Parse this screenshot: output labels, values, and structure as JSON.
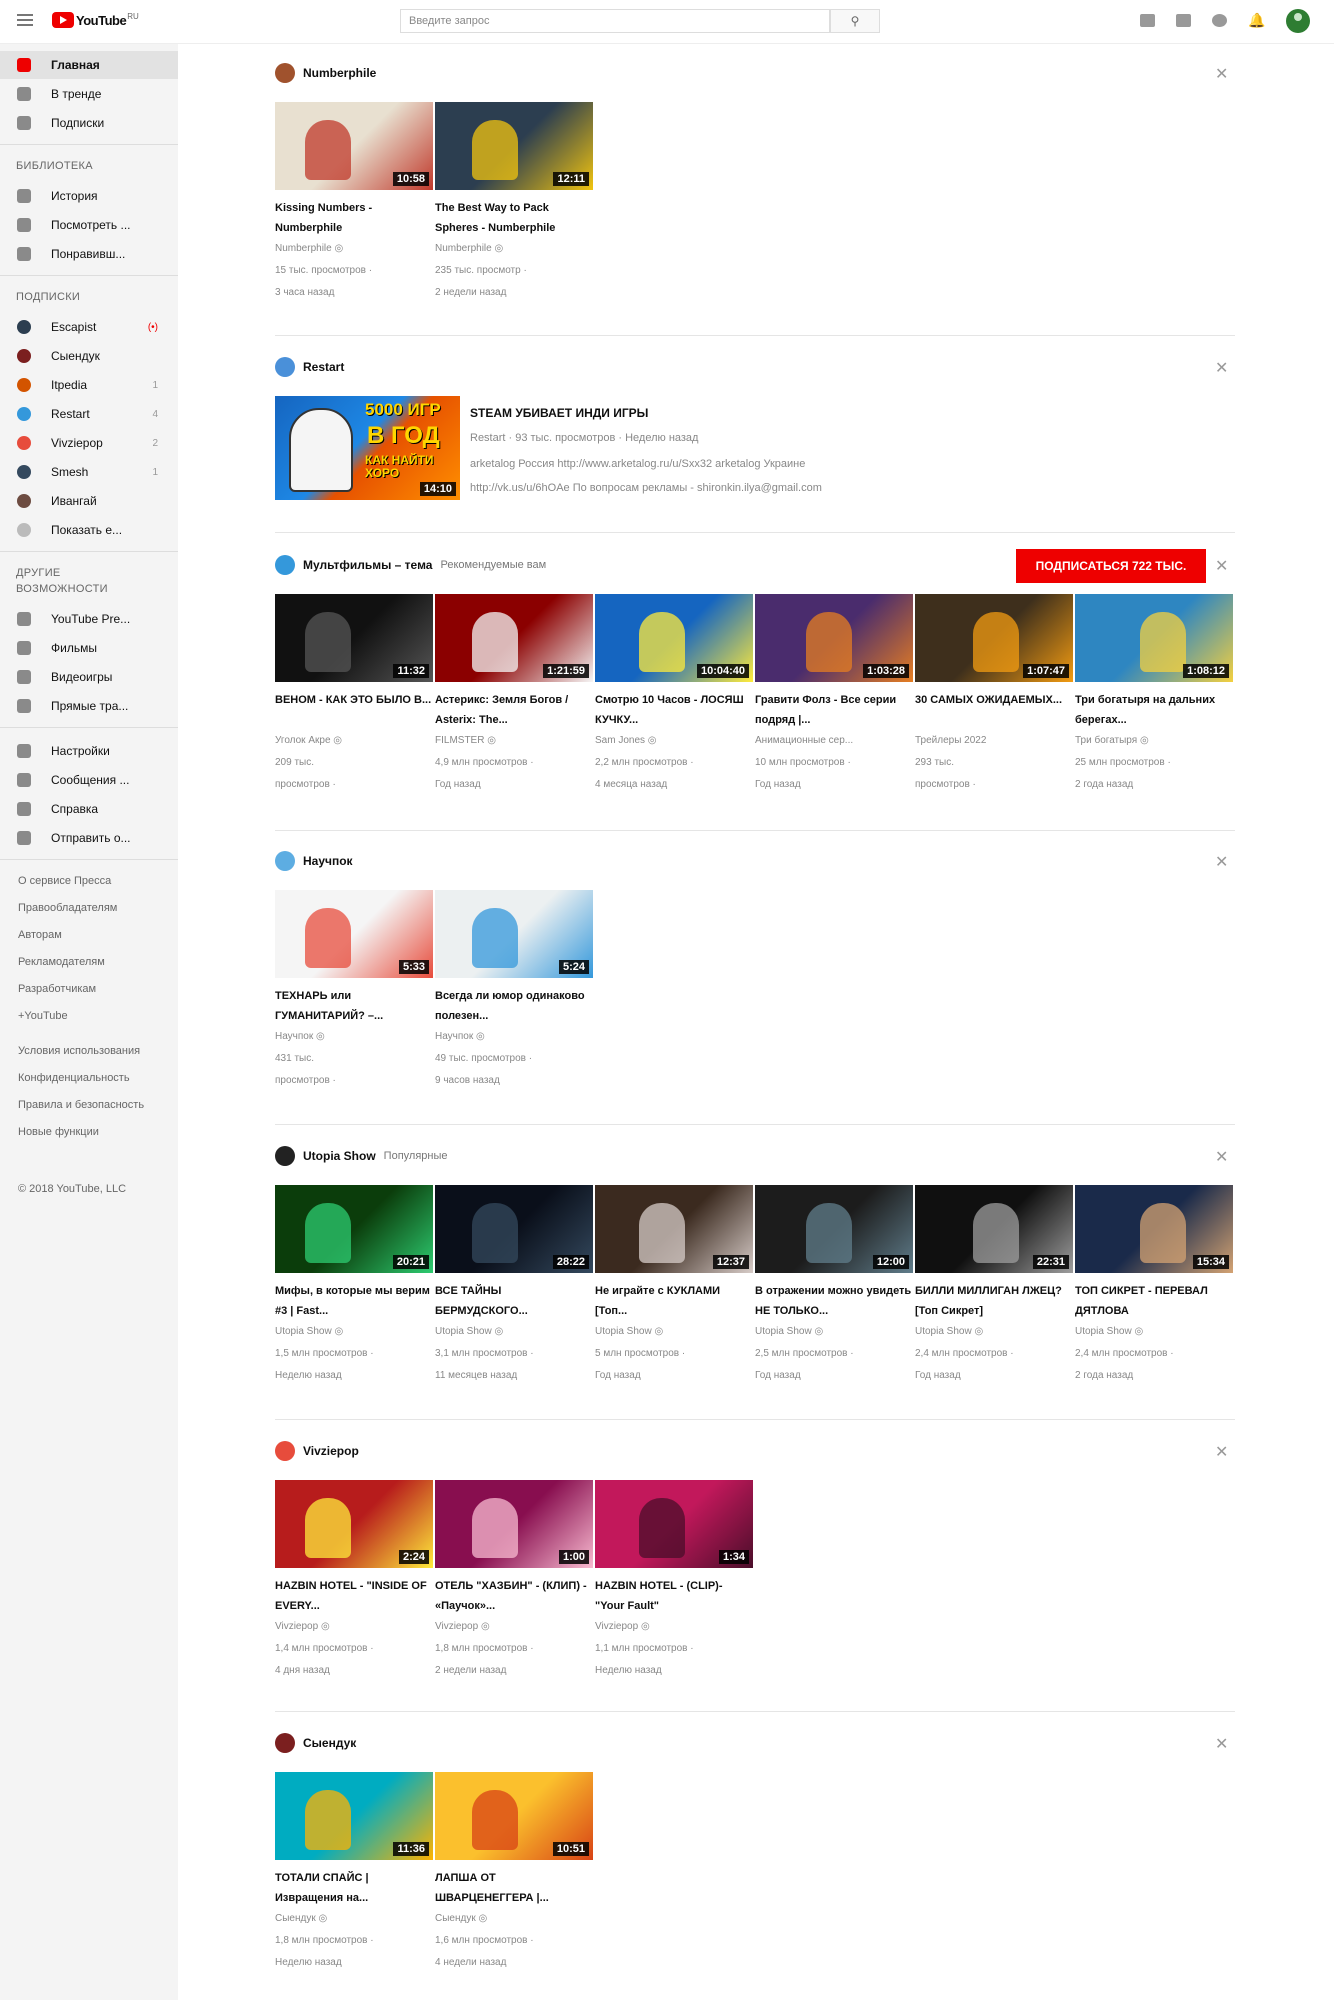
{
  "header": {
    "logo_text": "YouTube",
    "logo_region": "RU",
    "search_placeholder": "Введите запрос"
  },
  "sidebar": {
    "main": [
      {
        "label": "Главная",
        "icon": "home-icon",
        "active": true
      },
      {
        "label": "В тренде",
        "icon": "flame-icon"
      },
      {
        "label": "Подписки",
        "icon": "subscriptions-icon"
      }
    ],
    "library_header": "БИБЛИОТЕКА",
    "library": [
      {
        "label": "История",
        "icon": "history-icon"
      },
      {
        "label": "Посмотреть ...",
        "icon": "watch-later-icon"
      },
      {
        "label": "Понравивш...",
        "icon": "thumbs-up-icon"
      }
    ],
    "subscriptions_header": "ПОДПИСКИ",
    "subscriptions": [
      {
        "label": "Escapist",
        "count": "(•)"
      },
      {
        "label": "Сыендук",
        "count": ""
      },
      {
        "label": "Itpedia",
        "count": "1"
      },
      {
        "label": "Restart",
        "count": "4"
      },
      {
        "label": "Vivziepop",
        "count": "2"
      },
      {
        "label": "Smesh",
        "count": "1"
      },
      {
        "label": "Ивангай",
        "count": ""
      },
      {
        "label": "Показать е...",
        "count": ""
      }
    ],
    "other_header_1": "ДРУГИЕ",
    "other_header_2": "ВОЗМОЖНОСТИ",
    "other": [
      {
        "label": "YouTube Pre...",
        "icon": "youtube-premium-icon"
      },
      {
        "label": "Фильмы",
        "icon": "film-icon"
      },
      {
        "label": "Видеоигры",
        "icon": "gamepad-icon"
      },
      {
        "label": "Прямые тра...",
        "icon": "live-icon"
      }
    ],
    "settings": [
      {
        "label": "Настройки",
        "icon": "gear-icon"
      },
      {
        "label": "Сообщения ...",
        "icon": "flag-icon"
      },
      {
        "label": "Справка",
        "icon": "help-icon"
      },
      {
        "label": "Отправить о...",
        "icon": "feedback-icon"
      }
    ],
    "footer_links_1": [
      "О сервисе Пресса",
      "Правообладателям",
      "Авторам",
      "Рекламодателям",
      "Разработчикам",
      "+YouTube"
    ],
    "footer_links_2": [
      "Условия использования",
      "Конфиденциальность",
      "Правила и безопасность",
      "Новые функции"
    ],
    "copyright": "© 2018 YouTube, LLC"
  },
  "sections": [
    {
      "channel": "Numberphile",
      "subtitle": "",
      "icon_color": "#a0522d",
      "videos": [
        {
          "title": "Kissing Numbers - Numberphile",
          "channel": "Numberphile ◎",
          "views": "15 тыс. просмотров ·",
          "age": "3 часа назад",
          "duration": "10:58",
          "colors": [
            "#e8e0d0",
            "#c0392b"
          ]
        },
        {
          "title": "The Best Way to Pack Spheres - Numberphile",
          "channel": "Numberphile ◎",
          "views": "235 тыс. просмотр ·",
          "age": "2 недели назад",
          "duration": "12:11",
          "colors": [
            "#2c3e50",
            "#f1c40f"
          ]
        }
      ]
    },
    {
      "channel": "Restart",
      "subtitle": "",
      "icon_color": "#4a90d9",
      "wide": {
        "title": "STEAM УБИВАЕТ ИНДИ ИГРЫ",
        "meta": "Restart · 93 тыс. просмотров · Неделю назад",
        "line2": "arketalog Россия http://www.arketalog.ru/u/Sxx32 arketalog Украине",
        "line3": "http://vk.us/u/6hOAe По вопросам рекламы - shironkin.ilya@gmail.com",
        "duration": "14:10",
        "thumb_text_1": "5000 ИГР",
        "thumb_text_2": "В ГОД",
        "thumb_text_3": "КАК НАЙТИ ХОРО"
      }
    },
    {
      "channel": "Мультфильмы – тема",
      "subtitle": "Рекомендуемые вам",
      "icon_color": "#3498db",
      "subscribe": "ПОДПИСАТЬСЯ 722 ТЫС.",
      "videos": [
        {
          "title": "ВЕНОМ - КАК ЭТО БЫЛО В...",
          "channel": "Уголок Акре ◎",
          "views": "209 тыс.",
          "age": "просмотров ·",
          "duration": "11:32",
          "colors": [
            "#111111",
            "#555555"
          ]
        },
        {
          "title": "Астерикс: Земля Богов / Asterix: The...",
          "channel": "FILMSTER ◎",
          "views": "4,9 млн просмотров ·",
          "age": "Год назад",
          "duration": "1:21:59",
          "colors": [
            "#8b0000",
            "#f5f5f5"
          ]
        },
        {
          "title": "Смотрю 10 Часов - ЛОСЯШ КУЧКУ...",
          "channel": "Sam Jones ◎",
          "views": "2,2 млн просмотров ·",
          "age": "4 месяца назад",
          "duration": "10:04:40",
          "colors": [
            "#1565c0",
            "#ffeb3b"
          ]
        },
        {
          "title": "Гравити Фолз - Все серии подряд |...",
          "channel": "Анимационные сер...",
          "views": "10 млн просмотров ·",
          "age": "Год назад",
          "duration": "1:03:28",
          "colors": [
            "#4a2c6d",
            "#e67e22"
          ]
        },
        {
          "title": "30 САМЫХ ОЖИДАЕМЫХ...",
          "channel": "Трейлеры 2022",
          "views": "293 тыс.",
          "age": "просмотров ·",
          "duration": "1:07:47",
          "colors": [
            "#3e2f1c",
            "#f39c12"
          ]
        },
        {
          "title": "Три богатыря на дальних берегах...",
          "channel": "Три богатыря ◎",
          "views": "25 млн просмотров ·",
          "age": "2 года назад",
          "duration": "1:08:12",
          "colors": [
            "#2e86c1",
            "#f4d03f"
          ]
        }
      ]
    },
    {
      "channel": "Научпок",
      "subtitle": "",
      "icon_color": "#5dade2",
      "videos": [
        {
          "title": "ТЕХНАРЬ или ГУМАНИТАРИЙ? –...",
          "channel": "Научпок ◎",
          "views": "431 тыс.",
          "age": "просмотров ·",
          "duration": "5:33",
          "colors": [
            "#f5f5f5",
            "#e74c3c"
          ]
        },
        {
          "title": "Всегда ли юмор одинаково полезен...",
          "channel": "Научпок ◎",
          "views": "49 тыс. просмотров ·",
          "age": "9 часов назад",
          "duration": "5:24",
          "colors": [
            "#ecf0f1",
            "#3498db"
          ]
        }
      ]
    },
    {
      "channel": "Utopia Show",
      "subtitle": "Популярные",
      "icon_color": "#222222",
      "videos": [
        {
          "title": "Мифы, в которые мы верим #3 | Fast...",
          "channel": "Utopia Show ◎",
          "views": "1,5 млн просмотров ·",
          "age": "Неделю назад",
          "duration": "20:21",
          "colors": [
            "#0b3d0b",
            "#2ecc71"
          ]
        },
        {
          "title": "ВСЕ ТАЙНЫ БЕРМУДСКОГО...",
          "channel": "Utopia Show ◎",
          "views": "3,1 млн просмотров ·",
          "age": "11 месяцев назад",
          "duration": "28:22",
          "colors": [
            "#0a0f1a",
            "#34495e"
          ]
        },
        {
          "title": "Не играйте с КУКЛАМИ [Топ...",
          "channel": "Utopia Show ◎",
          "views": "5 млн просмотров ·",
          "age": "Год назад",
          "duration": "12:37",
          "colors": [
            "#3b2a1f",
            "#d7ccc8"
          ]
        },
        {
          "title": "В отражении можно увидеть НЕ ТОЛЬКО...",
          "channel": "Utopia Show ◎",
          "views": "2,5 млн просмотров ·",
          "age": "Год назад",
          "duration": "12:00",
          "colors": [
            "#1c1c1c",
            "#607d8b"
          ]
        },
        {
          "title": "БИЛЛИ МИЛЛИГАН ЛЖЕЦ? [Топ Сикрет]",
          "channel": "Utopia Show ◎",
          "views": "2,4 млн просмотров ·",
          "age": "Год назад",
          "duration": "22:31",
          "colors": [
            "#101010",
            "#9e9e9e"
          ]
        },
        {
          "title": "ТОП СИКРЕТ - ПЕРЕВАЛ ДЯТЛОВА",
          "channel": "Utopia Show ◎",
          "views": "2,4 млн просмотров ·",
          "age": "2 года назад",
          "duration": "15:34",
          "colors": [
            "#1a2a4a",
            "#d4a373"
          ]
        }
      ]
    },
    {
      "channel": "Vivziepop",
      "subtitle": "",
      "icon_color": "#e74c3c",
      "videos": [
        {
          "title": "HAZBIN HOTEL - \"INSIDE OF EVERY...",
          "channel": "Vivziepop ◎",
          "views": "1,4 млн просмотров ·",
          "age": "4 дня назад",
          "duration": "2:24",
          "colors": [
            "#b71c1c",
            "#ffeb3b"
          ]
        },
        {
          "title": "ОТЕЛЬ \"ХАЗБИН\" - (КЛИП) - «Паучок»...",
          "channel": "Vivziepop ◎",
          "views": "1,8 млн просмотров ·",
          "age": "2 недели назад",
          "duration": "1:00",
          "colors": [
            "#880e4f",
            "#f8bbd0"
          ]
        },
        {
          "title": "HAZBIN HOTEL - (CLIP)- \"Your Fault\"",
          "channel": "Vivziepop ◎",
          "views": "1,1 млн просмотров ·",
          "age": "Неделю назад",
          "duration": "1:34",
          "colors": [
            "#c2185b",
            "#4a0e2a"
          ]
        }
      ]
    },
    {
      "channel": "Сыендук",
      "subtitle": "",
      "icon_color": "#7b1f1f",
      "videos": [
        {
          "title": "ТОТАЛИ СПАЙС | Извращения на...",
          "channel": "Сыендук ◎",
          "views": "1,8 млн просмотров ·",
          "age": "Неделю назад",
          "duration": "11:36",
          "colors": [
            "#00acc1",
            "#ffb300"
          ]
        },
        {
          "title": "ЛАПША ОТ ШВАРЦЕНЕГГЕРА |...",
          "channel": "Сыендук ◎",
          "views": "1,6 млн просмотров ·",
          "age": "4 недели назад",
          "duration": "10:51",
          "colors": [
            "#fbc02d",
            "#d84315"
          ]
        }
      ]
    }
  ]
}
